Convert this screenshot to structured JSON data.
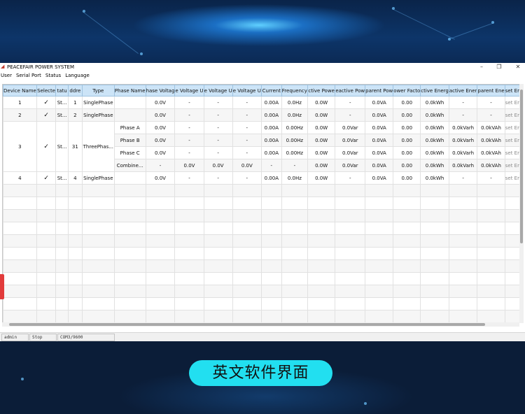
{
  "window": {
    "title": "PEACEFAIR POWER SYSTEM"
  },
  "menu": [
    "User",
    "Serial Port",
    "Status",
    "Language"
  ],
  "table": {
    "headers": [
      "Device Name",
      "Selecte",
      "tatu",
      "ddre",
      "Type",
      "Phase Name",
      "hase Voltag",
      "e Voltage U",
      "e Voltage U",
      "e Voltage U",
      "Current",
      "Frequency",
      "ctive Powe",
      "eactive Pow",
      "parent Pow",
      "ower Facto",
      "ctive Energ",
      "active Ener",
      "parent Ene",
      "set Er"
    ],
    "device1": [
      "1",
      "✓",
      "St...",
      "1",
      "SinglePhase",
      "",
      "0.0V",
      "-",
      "-",
      "-",
      "0.00A",
      "0.0Hz",
      "0.0W",
      "-",
      "0.0VA",
      "0.00",
      "0.0kWh",
      "-",
      "-",
      "set Er"
    ],
    "device2": [
      "2",
      "✓",
      "St...",
      "2",
      "SinglePhase",
      "",
      "0.0V",
      "-",
      "-",
      "-",
      "0.00A",
      "0.0Hz",
      "0.0W",
      "-",
      "0.0VA",
      "0.00",
      "0.0kWh",
      "-",
      "-",
      "set Er"
    ],
    "device3": {
      "name": "3",
      "selected": "✓",
      "status": "St...",
      "address": "31",
      "type": "ThreePhas...",
      "phases": [
        [
          "Phase A",
          "0.0V",
          "-",
          "-",
          "-",
          "0.00A",
          "0.00Hz",
          "0.0W",
          "0.0Var",
          "0.0VA",
          "0.00",
          "0.0kWh",
          "0.0kVarh",
          "0.0kVAh",
          "set Er"
        ],
        [
          "Phase B",
          "0.0V",
          "-",
          "-",
          "-",
          "0.00A",
          "0.00Hz",
          "0.0W",
          "0.0Var",
          "0.0VA",
          "0.00",
          "0.0kWh",
          "0.0kVarh",
          "0.0kVAh",
          "set Er"
        ],
        [
          "Phase C",
          "0.0V",
          "-",
          "-",
          "-",
          "0.00A",
          "0.00Hz",
          "0.0W",
          "0.0Var",
          "0.0VA",
          "0.00",
          "0.0kWh",
          "0.0kVarh",
          "0.0kVAh",
          "set Er"
        ],
        [
          "Combine...",
          "-",
          "0.0V",
          "0.0V",
          "0.0V",
          "-",
          "-",
          "0.0W",
          "0.0Var",
          "0.0VA",
          "0.00",
          "0.0kWh",
          "0.0kVarh",
          "0.0kVAh",
          "set Er"
        ]
      ]
    },
    "device4": [
      "4",
      "✓",
      "St...",
      "4",
      "SinglePhase",
      "",
      "0.0V",
      "-",
      "-",
      "-",
      "0.00A",
      "0.0Hz",
      "0.0W",
      "-",
      "0.0VA",
      "0.00",
      "0.0kWh",
      "-",
      "-",
      "set Er"
    ]
  },
  "statusbar": {
    "user": "admin",
    "state": "Stop",
    "port": "COM3/9600"
  },
  "caption": "英文软件界面",
  "colors": {
    "accent": "#22dff0",
    "header": "#cce4f7"
  }
}
